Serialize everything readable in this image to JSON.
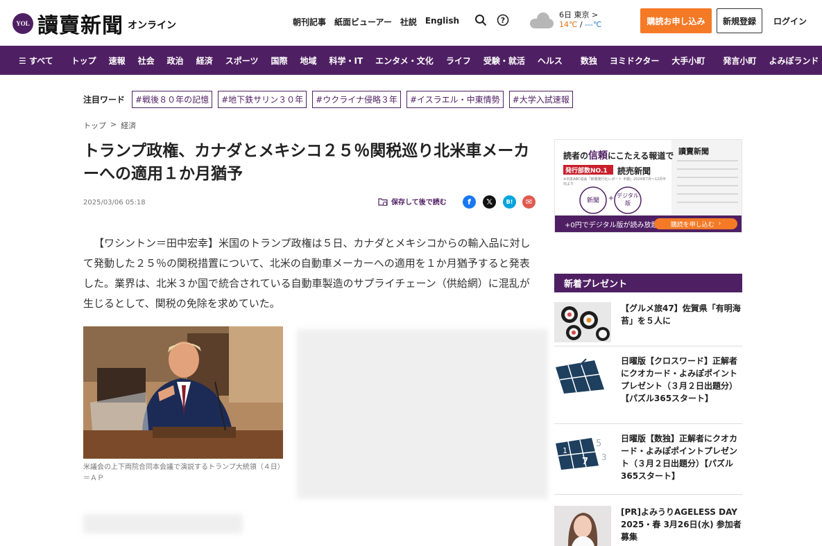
{
  "header": {
    "logo_badge": "YOL",
    "logo_text": "讀賣新聞",
    "logo_sub": "オンライン",
    "links": [
      "朝刊記事",
      "紙面ビューアー",
      "社説",
      "English"
    ],
    "weather": {
      "day": "6日",
      "city": "東京",
      "arrow": ">",
      "high": "14℃",
      "sep": " / ",
      "low": "---℃"
    },
    "subscribe_label": "購読お申し込み",
    "register_label": "新規登録",
    "login_label": "ログイン",
    "icons": [
      "search-icon",
      "help-icon",
      "cloud-icon"
    ]
  },
  "nav": {
    "all_label": "☰ すべて",
    "group1": [
      "トップ",
      "速報",
      "社会",
      "政治",
      "経済",
      "スポーツ",
      "国際",
      "地域",
      "科学・IT",
      "エンタメ・文化",
      "ライフ",
      "受験・就活",
      "ヘルス"
    ],
    "group2": [
      "数独",
      "ヨミドクター",
      "大手小町"
    ],
    "group3": [
      "発言小町",
      "よみぽランド"
    ]
  },
  "keywords": {
    "label": "注目ワード",
    "tags": [
      "#戦後８０年の記憶",
      "#地下鉄サリン３０年",
      "#ウクライナ侵略３年",
      "#イスラエル・中東情勢",
      "#大学入試速報"
    ]
  },
  "breadcrumb": {
    "home": "トップ",
    "sep": ">",
    "section": "経済"
  },
  "article": {
    "title": "トランプ政権、カナダとメキシコ２５％関税巡り北米車メーカーへの適用１か月猶予",
    "date": "2025/03/06 05:18",
    "save_label": "保存して後で読む",
    "share": [
      {
        "name": "facebook-icon",
        "glyph": "f",
        "color": "#1877f2"
      },
      {
        "name": "x-icon",
        "glyph": "𝕏",
        "color": "#111111"
      },
      {
        "name": "hatena-icon",
        "glyph": "B!",
        "color": "#00a4de"
      },
      {
        "name": "mail-icon",
        "glyph": "✉",
        "color": "#e05a4f"
      }
    ],
    "lede": "【ワシントン＝田中宏幸】米国のトランプ政権は５日、カナダとメキシコからの輸入品に対して発動した２５％の関税措置について、北米の自動車メーカーへの適用を１か月猶予すると発表した。業界は、北米３か国で統合されている自動車製造のサプライチェーン（供給網）に混乱が生じるとして、関税の免除を求めていた。",
    "photo_caption": "米議会の上下両院合同本会議で演説するトランプ大統領（４日）＝ＡＰ"
  },
  "ad": {
    "headline_pre": "読者の",
    "headline_em": "信頼",
    "headline_post": "にこたえる報道で",
    "badge": "発行部数NO.1",
    "paper_name": "読売新聞",
    "note": "※日本ABC協会「新聞発行社レポート 半期」2024年7月〜12月平均より",
    "circle1": "新聞",
    "circle2": "デジタル版",
    "plus": "+",
    "bar_text": "+0円でデジタル版が読み放題！",
    "button": "購読を申し込む",
    "masthead": "讀賣新聞"
  },
  "presents": {
    "heading": "新着プレゼント",
    "items": [
      {
        "text": "【グルメ旅47】佐賀県「有明海苔」を５人に"
      },
      {
        "text": "日曜版【クロスワード】正解者にクオカード・よみぽポイントプレゼント（３月２日出題分）【パズル365スタート】"
      },
      {
        "text": "日曜版【数独】正解者にクオカード・よみぽポイントプレゼント（３月２日出題分）【パズル365スタート】"
      },
      {
        "text": "[PR]よみうりAGELESS DAY 2025・春 3月26日(水) 参加者募集"
      }
    ]
  }
}
